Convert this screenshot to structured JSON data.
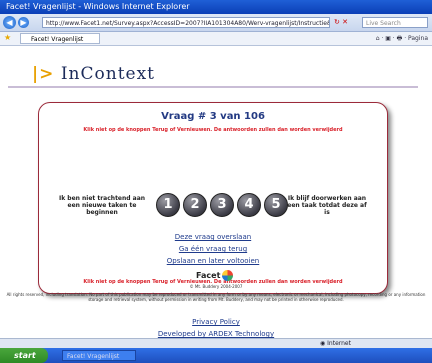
{
  "window": {
    "title": "Facet! Vragenlijst - Windows Internet Explorer"
  },
  "browser": {
    "address": "http://www.Facet1.net/Survey.aspx?AccessID=2007?IIA101304A80/Werv-vragenlijst/Instructie&maximaliseren",
    "search_placeholder": "Live Search",
    "tab_label": "Facet! Vragenlijst",
    "command_icons": "⌂ · ▣ · 🖶 · Pagina"
  },
  "logo": {
    "prefix": "|>",
    "text": "InContext"
  },
  "survey": {
    "question_title": "Vraag # 3 van 106",
    "instruction_top": "Klik niet op de knoppen Terug of Vernieuwen.  De antwoorden zullen dan worden verwijderd",
    "left_label": "Ik ben niet trachtend aan een nieuwe taken te beginnen",
    "right_label": "Ik blijf doorwerken aan een taak totdat deze af is",
    "options": [
      "1",
      "2",
      "3",
      "4",
      "5"
    ],
    "link_skip": "Deze vraag overslaan",
    "link_back": "Ga één vraag terug",
    "link_save": "Opslaan en later voltooien",
    "instruction_bottom": "Klik niet op de knoppen Terug of Vernieuwen.  De antwoorden zullen dan worden verwijderd"
  },
  "footer": {
    "brand": "Facet",
    "copyright": "© Mt. Buddery 2004-2007",
    "rights": "All rights reserved, including translation. No part of this publication may be reproduced or transmitted in any form or by any means, electronic or mechanical, including photocopy, recording or any information storage and retrieval system, without permission in writing from Mt. Buddery, and may not be printed in otherwise reproduced.",
    "privacy_link": "Privacy Policy",
    "developed_link": "Developed by ARDEX Technology"
  },
  "status": {
    "zone": "Internet"
  },
  "taskbar": {
    "start": "start",
    "task": "Facet! Vragenlijst"
  }
}
